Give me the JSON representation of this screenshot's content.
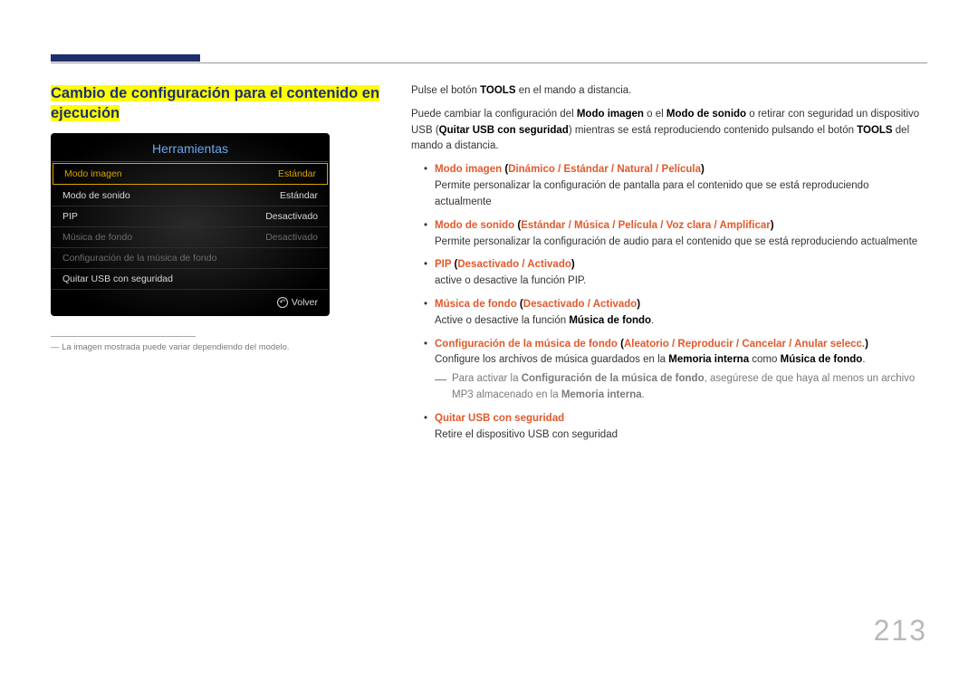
{
  "section_title_l1": "Cambio de configuración para el contenido en",
  "section_title_l2": "ejecución",
  "panel": {
    "title": "Herramientas",
    "rows": [
      {
        "label": "Modo imagen",
        "value": "Estándar",
        "style": "selected"
      },
      {
        "label": "Modo de sonido",
        "value": "Estándar",
        "style": "normal"
      },
      {
        "label": "PIP",
        "value": "Desactivado",
        "style": "normal"
      },
      {
        "label": "Música de fondo",
        "value": "Desactivado",
        "style": "dim"
      },
      {
        "label": "Configuración de la música de fondo",
        "value": "",
        "style": "dim"
      },
      {
        "label": "Quitar USB con seguridad",
        "value": "",
        "style": "normal"
      }
    ],
    "return_label": "Volver"
  },
  "footnote_prefix": "―",
  "footnote": "La imagen mostrada puede variar dependiendo del modelo.",
  "r": {
    "p1_a": "Pulse el botón ",
    "p1_b": "TOOLS",
    "p1_c": " en el mando a distancia.",
    "p2_a": "Puede cambiar la configuración del ",
    "p2_b": "Modo imagen",
    "p2_c": " o el ",
    "p2_d": "Modo de sonido",
    "p2_e": " o retirar con seguridad un dispositivo USB (",
    "p2_f": "Quitar USB con seguridad",
    "p2_g": ") mientras se está reproduciendo contenido pulsando el botón ",
    "p2_h": "TOOLS",
    "p2_i": " del mando a distancia.",
    "b1_head": "Modo imagen",
    "b1_open": " (",
    "b1_o1": "Dinámico",
    "b1_s": " / ",
    "b1_o2": "Estándar",
    "b1_o3": "Natural",
    "b1_o4": "Película",
    "b1_close": ")",
    "b1_desc": "Permite personalizar la configuración de pantalla para el contenido que se está reproduciendo actualmente",
    "b2_head": "Modo de sonido",
    "b2_o1": "Estándar",
    "b2_o2": "Música",
    "b2_o3": "Película",
    "b2_o4": "Voz clara",
    "b2_o5": "Amplificar",
    "b2_desc": "Permite personalizar la configuración de audio para el contenido que se está reproduciendo actualmente",
    "b3_head": "PIP",
    "b3_o1": "Desactivado",
    "b3_o2": "Activado",
    "b3_desc": "active o desactive la función PIP.",
    "b4_head": "Música de fondo",
    "b4_o1": "Desactivado",
    "b4_o2": "Activado",
    "b4_desc_a": "Active o desactive la función ",
    "b4_desc_b": "Música de fondo",
    "b4_desc_c": ".",
    "b5_head": "Configuración de la música de fondo",
    "b5_o1": "Aleatorio",
    "b5_o2": "Reproducir",
    "b5_o3": "Cancelar",
    "b5_o4": "Anular selecc.",
    "b5_desc_a": "Configure los archivos de música guardados en la ",
    "b5_desc_b": "Memoria interna",
    "b5_desc_c": " como ",
    "b5_desc_d": "Música de fondo",
    "b5_desc_e": ".",
    "sub_dash": "―",
    "sub_a": "Para activar la ",
    "sub_b": "Configuración de la música de fondo",
    "sub_c": ", asegúrese de que haya al menos un archivo MP3 almacenado en la ",
    "sub_d": "Memoria interna",
    "sub_e": ".",
    "b6_head": "Quitar USB con seguridad",
    "b6_desc": "Retire el dispositivo USB con seguridad"
  },
  "page_number": "213"
}
